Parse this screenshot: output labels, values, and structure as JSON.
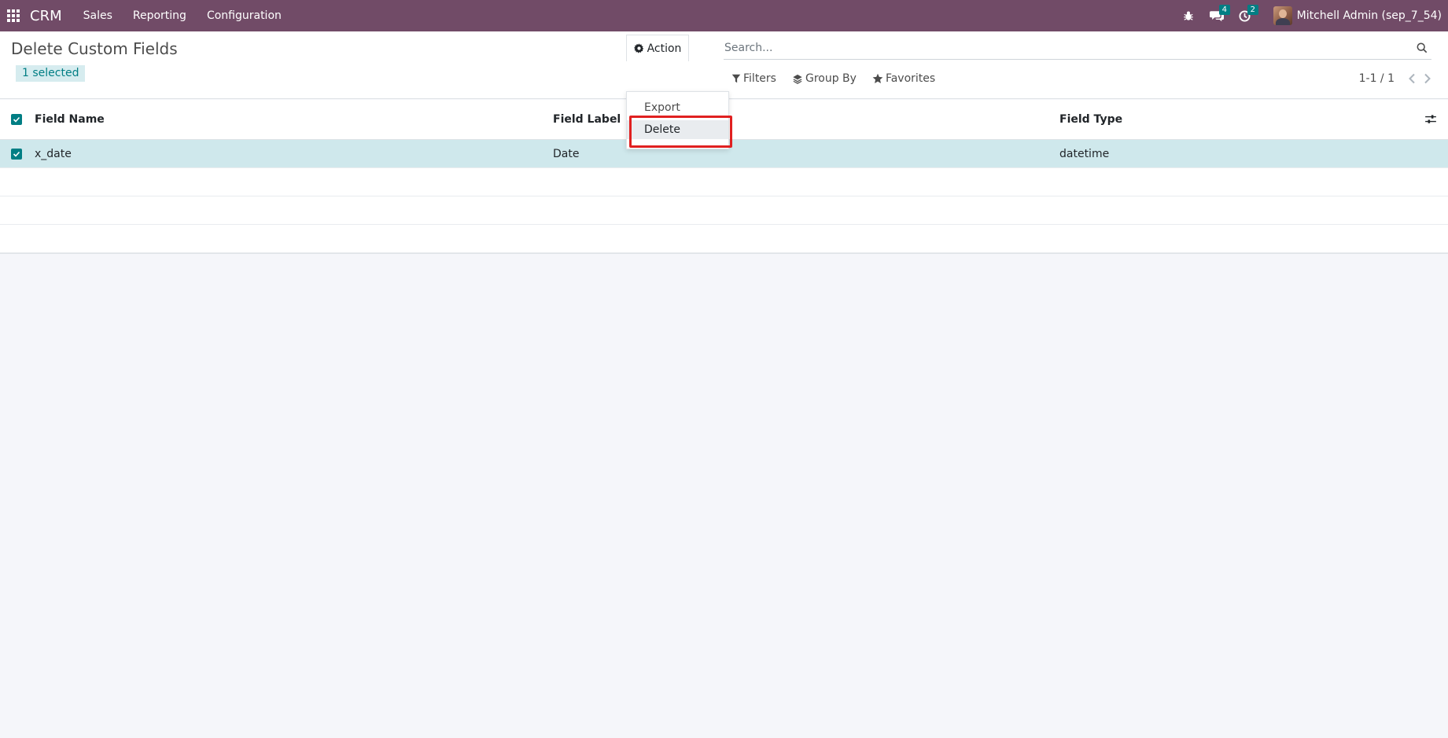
{
  "navbar": {
    "brand": "CRM",
    "menu": [
      "Sales",
      "Reporting",
      "Configuration"
    ],
    "messages_count": "4",
    "activities_count": "2",
    "user_name": "Mitchell Admin (sep_7_54)"
  },
  "control_panel": {
    "title": "Delete Custom Fields",
    "selected_label": "1 selected",
    "search_placeholder": "Search...",
    "action_label": "Action",
    "filters_label": "Filters",
    "groupby_label": "Group By",
    "favorites_label": "Favorites",
    "pager_value": "1-1 / 1"
  },
  "action_menu": {
    "items": [
      "Export",
      "Delete"
    ]
  },
  "list": {
    "columns": [
      "Field Name",
      "Field Label",
      "Field Type"
    ],
    "rows": [
      {
        "name": "x_date",
        "label": "Date",
        "type": "datetime",
        "selected": true
      }
    ]
  },
  "colors": {
    "navbar": "#714b67",
    "accent": "#017e84",
    "selected_row": "#cfe8ec",
    "highlight": "#e02020"
  }
}
